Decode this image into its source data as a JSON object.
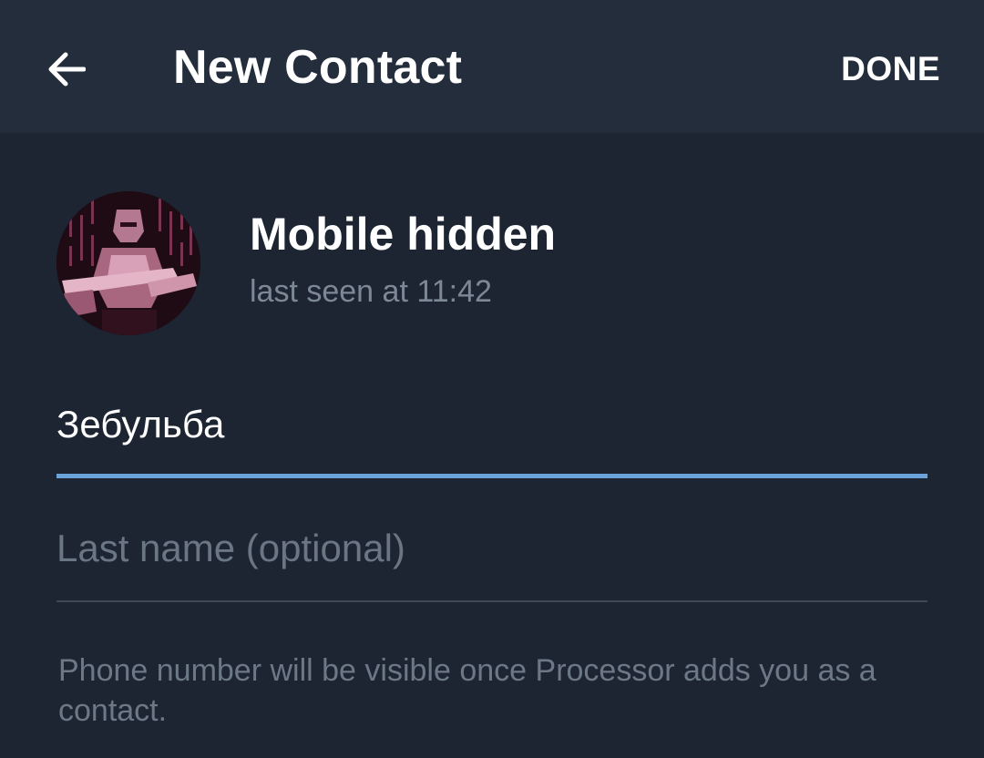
{
  "header": {
    "back_icon": "arrow-left-icon",
    "title": "New Contact",
    "done_label": "DONE"
  },
  "profile": {
    "name": "Mobile hidden",
    "status": "last seen at 11:42"
  },
  "form": {
    "first_name_value": "Зебульба",
    "last_name_placeholder": "Last name (optional)",
    "hint": "Phone number will be visible once Processor adds you as a contact."
  },
  "colors": {
    "background": "#1d2532",
    "header_background": "#232d3b",
    "accent_underline": "#6aa4da",
    "secondary_text": "#7d8896"
  }
}
